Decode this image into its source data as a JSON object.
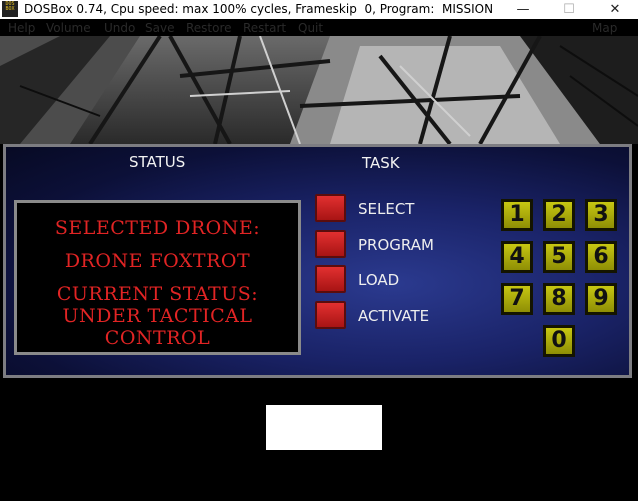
{
  "window": {
    "icon_label": "DOS BOX",
    "title": "DOSBox 0.74, Cpu speed: max 100% cycles, Frameskip  0, Program:  MISSION",
    "minimize_glyph": "—",
    "maximize_glyph": "☐",
    "close_glyph": "✕"
  },
  "menu": {
    "items": [
      "Help",
      "Volume",
      "Undo",
      "Save",
      "Restore",
      "Restart",
      "Quit"
    ],
    "right": "Map"
  },
  "headers": {
    "status": "STATUS",
    "task": "TASK"
  },
  "status_display": {
    "line1": "SELECTED DRONE:",
    "line2": "DRONE FOXTROT",
    "line3": "CURRENT STATUS:",
    "line4": "UNDER TACTICAL",
    "line5": "CONTROL"
  },
  "tasks": [
    "SELECT",
    "PROGRAM",
    "LOAD",
    "ACTIVATE"
  ],
  "keypad": [
    "1",
    "2",
    "3",
    "4",
    "5",
    "6",
    "7",
    "8",
    "9",
    "0"
  ],
  "colors": {
    "status_text": "#e12424",
    "task_button": "#d22020",
    "keypad_key": "#b0b00c",
    "panel_bg": "#1a2368"
  }
}
